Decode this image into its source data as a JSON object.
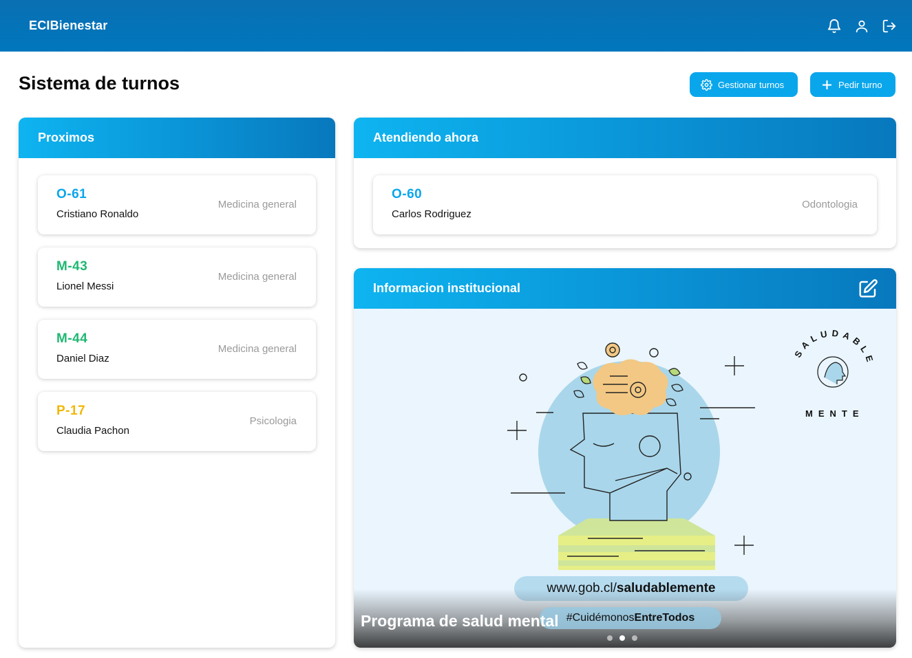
{
  "app": {
    "brand": "ECIBienestar"
  },
  "header_icons": [
    "bell-icon",
    "user-icon",
    "logout-icon"
  ],
  "page": {
    "title": "Sistema de turnos"
  },
  "actions": {
    "manage_label": "Gestionar turnos",
    "request_label": "Pedir turno"
  },
  "next_panel": {
    "title": "Proximos",
    "items": [
      {
        "code": "O-61",
        "name": "Cristiano Ronaldo",
        "service": "Medicina general",
        "color": "#0aa6ec"
      },
      {
        "code": "M-43",
        "name": "Lionel Messi",
        "service": "Medicina general",
        "color": "#1fb872"
      },
      {
        "code": "M-44",
        "name": "Daniel Diaz",
        "service": "Medicina general",
        "color": "#1fb872"
      },
      {
        "code": "P-17",
        "name": "Claudia Pachon",
        "service": "Psicologia",
        "color": "#f2b705"
      }
    ]
  },
  "now_panel": {
    "title": "Atendiendo ahora",
    "current": {
      "code": "O-60",
      "name": "Carlos Rodriguez",
      "service": "Odontologia",
      "color": "#0aa6ec"
    }
  },
  "info_panel": {
    "title": "Informacion institucional",
    "slide": {
      "caption": "Programa de salud mental",
      "url_prefix": "www.gob.cl/",
      "url_bold": "saludablemente",
      "hashtag_prefix": "#Cuidémonos",
      "hashtag_bold": "EntreTodos",
      "logo_top": "SALUDABLE",
      "logo_bottom": "MENTE"
    },
    "carousel": {
      "count": 3,
      "active_index": 1
    }
  },
  "colors": {
    "header": "#0077bd",
    "accent": "#0aa6ec"
  }
}
